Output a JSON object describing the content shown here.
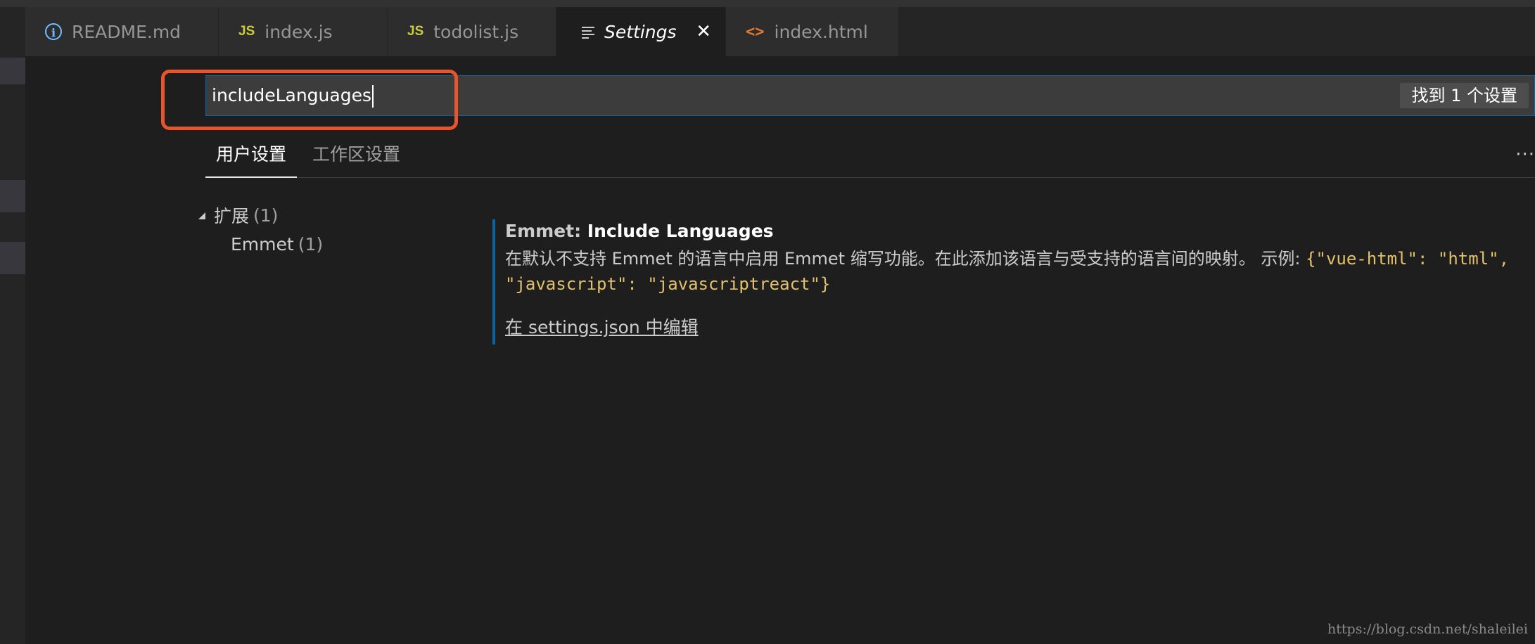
{
  "tabs": [
    {
      "label": "README.md",
      "icon": "info-icon"
    },
    {
      "label": "index.js",
      "icon": "js-file-icon"
    },
    {
      "label": "todolist.js",
      "icon": "js-file-icon"
    },
    {
      "label": "Settings",
      "icon": "settings-lines-icon",
      "active": true,
      "close": "✕"
    },
    {
      "label": "index.html",
      "icon": "html-file-icon"
    }
  ],
  "icons": {
    "info_glyph": "i",
    "js_glyph": "JS",
    "html_glyph": "<>"
  },
  "search": {
    "value": "includeLanguages",
    "result_count": "找到 1 个设置"
  },
  "scope_tabs": {
    "user": "用户设置",
    "workspace": "工作区设置",
    "more": "···"
  },
  "tree": {
    "group_label": "扩展",
    "group_count": "(1)",
    "item_label": "Emmet",
    "item_count": "(1)"
  },
  "setting": {
    "category": "Emmet: ",
    "name": "Include Languages",
    "description": "在默认不支持 Emmet 的语言中启用 Emmet 缩写功能。在此添加该语言与受支持的语言间的映射。 示例: ",
    "example": "{\"vue-html\": \"html\", \"javascript\": \"javascriptreact\"}",
    "edit_link": "在 settings.json 中编辑"
  },
  "watermark": "https://blog.csdn.net/shaleilei",
  "colors": {
    "highlight": "#e8542b",
    "accent": "#0e639c",
    "code": "#e3c06b"
  }
}
